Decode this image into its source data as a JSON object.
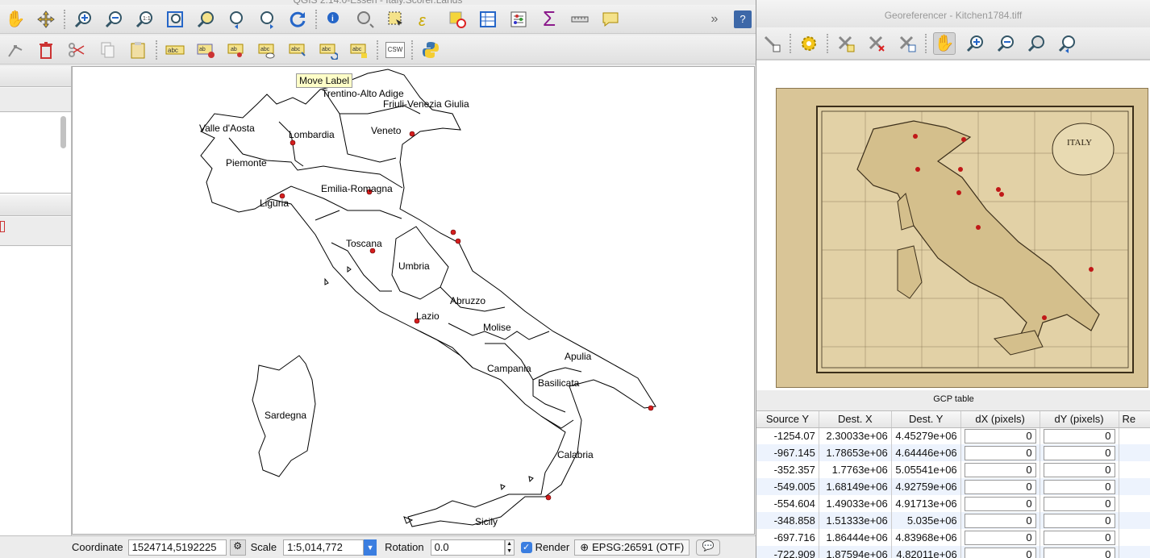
{
  "qgis": {
    "title": "QGIS 2.14.0-Essen - Italy.Scorer.Lands",
    "tooltip": "Move Label",
    "status": {
      "coordinate_label": "Coordinate",
      "coordinate_value": "1524714,5192225",
      "scale_label": "Scale",
      "scale_value": "1:5,014,772",
      "rotation_label": "Rotation",
      "rotation_value": "0.0",
      "render_label": "Render",
      "crs_label": "EPSG:26591 (OTF)"
    },
    "toolbar1": [
      "pan-icon",
      "pan-to-selection-icon",
      "zoom-in-icon",
      "zoom-out-icon",
      "zoom-native-icon",
      "zoom-full-icon",
      "zoom-layer-icon",
      "zoom-last-icon",
      "zoom-next-icon",
      "refresh-icon",
      "identify-icon",
      "select-tool-icon",
      "select-by-rect-icon",
      "expression-select-icon",
      "deselect-icon",
      "attribute-table-icon",
      "statistics-icon",
      "sum-icon",
      "measure-icon",
      "annotation-icon"
    ],
    "toolbar2": [
      "node-tool-icon",
      "delete-icon",
      "cut-icon",
      "copy-icon",
      "paste-icon",
      "label-icon",
      "pin-label-icon",
      "show-hide-label-icon",
      "preview-label-icon",
      "move-label-icon",
      "rotate-label-icon",
      "change-label-icon",
      "csw-icon",
      "python-icon"
    ],
    "csw_text": "CSW",
    "overflow_label": "»",
    "help_label": "?",
    "regions": [
      "Trentino-Alto Adige",
      "Friuli-Venezia Giulia",
      "Valle d'Aosta",
      "Lombardia",
      "Veneto",
      "Piemonte",
      "Emilia-Romagna",
      "Liguria",
      "Toscana",
      "Umbria",
      "Abruzzo",
      "Lazio",
      "Molise",
      "Apulia",
      "Campania",
      "Basilicata",
      "Sardegna",
      "Calabria",
      "Sicily"
    ]
  },
  "georef": {
    "title": "Georeferencer - Kitchen1784.tiff",
    "toolbar": [
      "link-qgis-icon",
      "gear-icon",
      "add-point-icon",
      "delete-point-icon",
      "move-point-icon",
      "pan-icon",
      "zoom-in-icon",
      "zoom-out-icon",
      "zoom-layer-icon",
      "zoom-last-icon"
    ],
    "map_title": "ITALY",
    "gcp_title": "GCP table",
    "columns": [
      "Source Y",
      "Dest. X",
      "Dest. Y",
      "dX (pixels)",
      "dY (pixels)",
      "Re"
    ],
    "rows": [
      [
        "-1254.07",
        "2.30033e+06",
        "4.45279e+06",
        "0",
        "0"
      ],
      [
        "-967.145",
        "1.78653e+06",
        "4.64446e+06",
        "0",
        "0"
      ],
      [
        "-352.357",
        "1.7763e+06",
        "5.05541e+06",
        "0",
        "0"
      ],
      [
        "-549.005",
        "1.68149e+06",
        "4.92759e+06",
        "0",
        "0"
      ],
      [
        "-554.604",
        "1.49033e+06",
        "4.91713e+06",
        "0",
        "0"
      ],
      [
        "-348.858",
        "1.51333e+06",
        "5.035e+06",
        "0",
        "0"
      ],
      [
        "-697.716",
        "1.86444e+06",
        "4.83968e+06",
        "0",
        "0"
      ],
      [
        "-722.909",
        "1.87594e+06",
        "4.82011e+06",
        "0",
        "0"
      ]
    ]
  }
}
